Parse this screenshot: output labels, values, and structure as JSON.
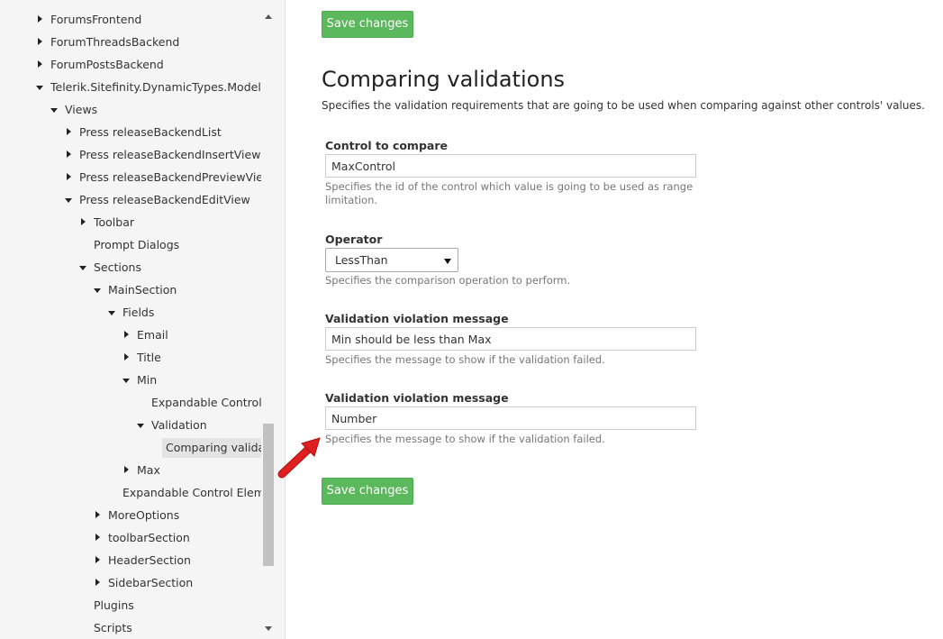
{
  "sidebar": {
    "items": [
      {
        "label": "ForumsFrontend",
        "level": 0,
        "arrow": "right"
      },
      {
        "label": "ForumThreadsBackend",
        "level": 0,
        "arrow": "right"
      },
      {
        "label": "ForumPostsBackend",
        "level": 0,
        "arrow": "right"
      },
      {
        "label": "Telerik.Sitefinity.DynamicTypes.Model.Pre",
        "level": 0,
        "arrow": "down"
      },
      {
        "label": "Views",
        "level": 1,
        "arrow": "down"
      },
      {
        "label": "Press releaseBackendList",
        "level": 2,
        "arrow": "right"
      },
      {
        "label": "Press releaseBackendInsertView",
        "level": 2,
        "arrow": "right"
      },
      {
        "label": "Press releaseBackendPreviewView",
        "level": 2,
        "arrow": "right"
      },
      {
        "label": "Press releaseBackendEditView",
        "level": 2,
        "arrow": "down"
      },
      {
        "label": "Toolbar",
        "level": 3,
        "arrow": "right"
      },
      {
        "label": "Prompt Dialogs",
        "level": 3,
        "arrow": "none"
      },
      {
        "label": "Sections",
        "level": 3,
        "arrow": "down"
      },
      {
        "label": "MainSection",
        "level": 4,
        "arrow": "down"
      },
      {
        "label": "Fields",
        "level": 5,
        "arrow": "down"
      },
      {
        "label": "Email",
        "level": 6,
        "arrow": "right"
      },
      {
        "label": "Title",
        "level": 6,
        "arrow": "right"
      },
      {
        "label": "Min",
        "level": 6,
        "arrow": "down"
      },
      {
        "label": "Expandable Control E",
        "level": 7,
        "arrow": "none"
      },
      {
        "label": "Validation",
        "level": 7,
        "arrow": "down"
      },
      {
        "label": "Comparing validat",
        "level": 8,
        "arrow": "none",
        "selected": true
      },
      {
        "label": "Max",
        "level": 6,
        "arrow": "right"
      },
      {
        "label": "Expandable Control Elemer",
        "level": 5,
        "arrow": "none"
      },
      {
        "label": "MoreOptions",
        "level": 4,
        "arrow": "right"
      },
      {
        "label": "toolbarSection",
        "level": 4,
        "arrow": "right"
      },
      {
        "label": "HeaderSection",
        "level": 4,
        "arrow": "right"
      },
      {
        "label": "SidebarSection",
        "level": 4,
        "arrow": "right"
      },
      {
        "label": "Plugins",
        "level": 3,
        "arrow": "none"
      },
      {
        "label": "Scripts",
        "level": 3,
        "arrow": "none"
      }
    ]
  },
  "main": {
    "save_label": "Save changes",
    "title": "Comparing validations",
    "description": "Specifies the validation requirements that are going to be used when comparing against other controls' values.",
    "fields": {
      "control_to_compare": {
        "label": "Control to compare",
        "value": "MaxControl",
        "help": "Specifies the id of the control which value is going to be used as range limitation."
      },
      "operator": {
        "label": "Operator",
        "value": "LessThan",
        "help": "Specifies the comparison operation to perform."
      },
      "violation_message": {
        "label": "Validation violation message",
        "value": "Min should be less than Max",
        "help": "Specifies the message to show if the validation failed."
      },
      "violation_message_2": {
        "label": "Validation violation message",
        "value": "Number",
        "help": "Specifies the message to show if the validation failed."
      }
    }
  },
  "colors": {
    "button": "#5cb85c",
    "annotation_arrow": "#e02020"
  }
}
